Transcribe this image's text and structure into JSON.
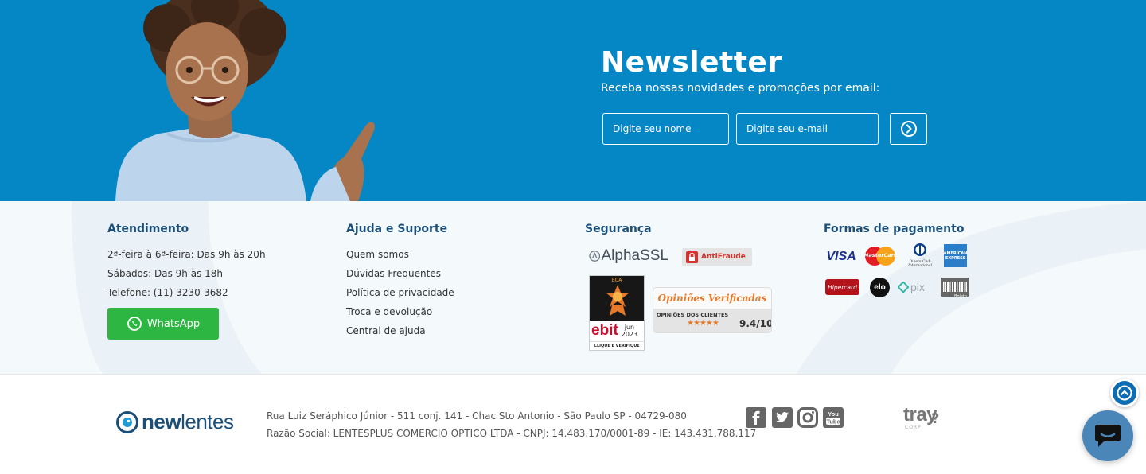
{
  "newsletter": {
    "title": "Newsletter",
    "subtitle": "Receba nossas novidades e promoções por email:",
    "name_placeholder": "Digite seu nome",
    "email_placeholder": "Digite seu e-mail",
    "submit_icon": "arrow-right-circle-icon"
  },
  "footer": {
    "atendimento": {
      "title": "Atendimento",
      "lines": [
        "2ª-feira à 6ª-feira: Das 9h às 20h",
        "Sábados: Das 9h às 18h",
        "Telefone: (11) 3230-3682"
      ],
      "whatsapp_label": "WhatsApp"
    },
    "ajuda": {
      "title": "Ajuda e Suporte",
      "links": [
        "Quem somos",
        "Dúvidas Frequentes",
        "Política de privacidade",
        "Troca e devolução",
        "Central de ajuda"
      ]
    },
    "seguranca": {
      "title": "Segurança",
      "alphassl": "AlphaSSL",
      "antifraude": "AntiFraude",
      "ebit_top": "BOA",
      "ebit_brand": "ebit",
      "ebit_month": "jun",
      "ebit_year": "2023",
      "ebit_cta": "CLIQUE E VERIFIQUE",
      "opinioes_title": "Opiniões Verificadas",
      "opinioes_sub": "OPINIÕES DOS CLIENTES",
      "opinioes_stars": "★★★★★",
      "opinioes_score": "9.4/10"
    },
    "pagamento": {
      "title": "Formas de pagamento",
      "visa": "VISA",
      "mastercard": "MasterCard",
      "diners": "Diners Club International",
      "amex": "AMERICAN EXPRESS",
      "hipercard": "Hipercard",
      "elo": "elo",
      "pix": "pix",
      "boleto": "Boleto"
    }
  },
  "bottom": {
    "logo_new": "new",
    "logo_lentes": "lentes",
    "address": "Rua Luiz Seráphico Júnior - 511 conj. 141 - Chac Sto Antonio - São Paulo SP - 04729-080",
    "company": "Razão Social: LENTESPLUS COMERCIO OPTICO LTDA - CNPJ: 14.483.170/0001-89 - IE: 143.431.788.117",
    "tray": "tray",
    "tray_sub": "CORP"
  },
  "colors": {
    "banner": "#0587c6",
    "heading": "#1c4f77",
    "whatsapp": "#2db742",
    "chat": "#4a86b8"
  }
}
